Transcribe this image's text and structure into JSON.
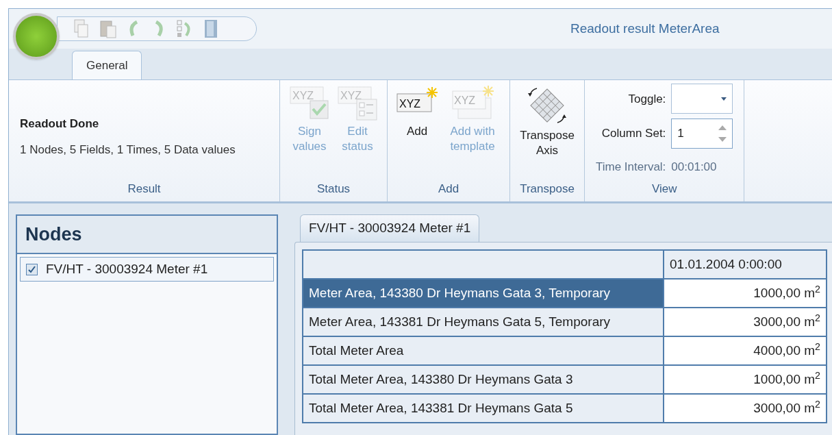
{
  "window": {
    "title": "Readout result MeterArea"
  },
  "ribbon_tabs": [
    {
      "label": "General",
      "selected": true
    }
  ],
  "groups": [
    {
      "kind": "info",
      "label": "Result",
      "title": "Readout Done",
      "summary": "1 Nodes, 5 Fields, 1 Times, 5 Data values"
    },
    {
      "kind": "buttons",
      "label": "Status",
      "buttons": [
        {
          "kind": "sign",
          "label": "Sign values",
          "icon_text": "XYZ",
          "disabled": true
        },
        {
          "kind": "edit-status",
          "label": "Edit status",
          "icon_text": "XYZ",
          "disabled": true
        }
      ]
    },
    {
      "kind": "buttons",
      "label": "Add",
      "buttons": [
        {
          "kind": "add",
          "label": "Add",
          "icon_text": "XYZ",
          "disabled": false
        },
        {
          "kind": "add-template",
          "label": "Add with template",
          "icon_text": "XYZ",
          "disabled": true
        }
      ]
    },
    {
      "kind": "buttons",
      "label": "Transpose",
      "buttons": [
        {
          "kind": "transpose",
          "label": "Transpose Axis",
          "disabled": false
        }
      ]
    },
    {
      "kind": "view",
      "label": "View",
      "toggle_label": "Toggle:",
      "column_set_label": "Column Set:",
      "column_set_value": "1",
      "time_interval_label": "Time Interval:",
      "time_interval_value": "00:01:00"
    }
  ],
  "nodes": {
    "title": "Nodes",
    "items": [
      {
        "label": "FV/HT - 30003924 Meter #1",
        "checked": true
      }
    ]
  },
  "data_tabs": [
    {
      "label": "FV/HT - 30003924 Meter #1",
      "selected": true
    }
  ],
  "table": {
    "columns": [
      "01.01.2004 0:00:00"
    ],
    "rows": [
      {
        "label": "Meter Area, 143380 Dr Heymans Gata 3, Temporary",
        "value": "1000,00 m$^{2}$",
        "selected": true
      },
      {
        "label": "Meter Area, 143381 Dr Heymans Gata 5, Temporary",
        "value": "3000,00 m$^{2}$",
        "selected": false
      },
      {
        "label": "Total Meter Area",
        "value": "4000,00 m$^{2}$",
        "selected": false
      },
      {
        "label": "Total Meter Area, 143380 Dr Heymans Gata 3",
        "value": "1000,00 m$^{2}$",
        "selected": false
      },
      {
        "label": "Total Meter Area, 143381 Dr Heymans Gata 5",
        "value": "3000,00 m$^{2}$",
        "selected": false
      }
    ]
  }
}
